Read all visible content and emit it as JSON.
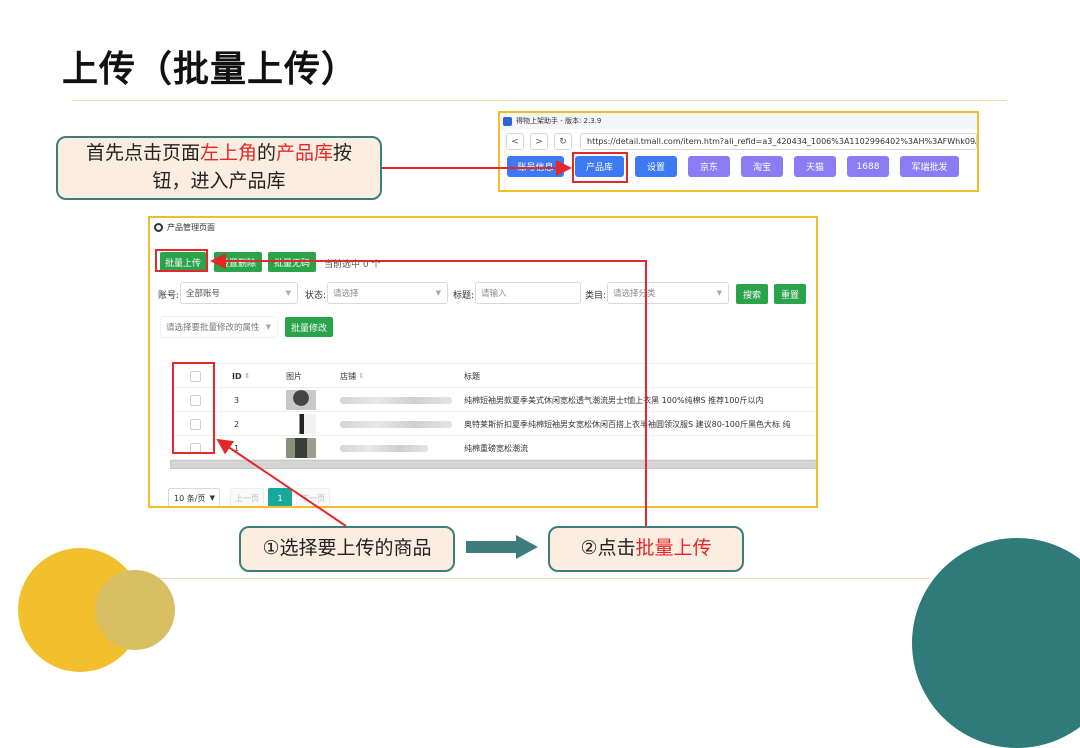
{
  "slide": {
    "title": "上传（批量上传）",
    "callout1": {
      "p1": "首先点击页面",
      "r1": "左上角",
      "p2": "的",
      "r2": "产品库",
      "p3": "按",
      "line2": "钮，进入产品库"
    },
    "callout2": "①选择要上传的商品",
    "callout3": {
      "prefix": "②点击",
      "highlight": "批量上传"
    }
  },
  "colors": {
    "accent_red": "#e4272b",
    "teal": "#3d7e7d",
    "callout_bg": "#fbeee0",
    "green": "#2aa34a",
    "blue_tab": "#3d79f2",
    "purple_tab": "#8b7cf3",
    "border_gold": "#f1bd2a"
  },
  "top_app": {
    "title": "得物上架助手 - 版本: 2.3.9",
    "nav": {
      "back": "<",
      "forward": ">",
      "refresh": "↻"
    },
    "url": "https://detail.tmall.com/item.htm?ali_refid=a3_420434_1006%3A1102996402%3AH%3AFWhk09A41iS",
    "tabs": [
      {
        "label": "账号信息"
      },
      {
        "label": "产品库"
      },
      {
        "label": "设置"
      },
      {
        "label": "京东"
      },
      {
        "label": "淘宝"
      },
      {
        "label": "天猫"
      },
      {
        "label": "1688"
      },
      {
        "label": "军瑞批发"
      }
    ]
  },
  "product_page": {
    "title": "产品管理页面",
    "actions": {
      "batch_upload": "批量上传",
      "btn2": "设置删除",
      "btn3": "批量无码",
      "selected": "当前选中 0 个"
    },
    "filters": {
      "account_label": "账号:",
      "account_value": "全部账号",
      "status_label": "状态:",
      "status_placeholder": "请选择",
      "title_label": "标题:",
      "title_placeholder": "请输入",
      "category_label": "类目:",
      "category_placeholder": "请选择分类",
      "search": "搜索",
      "reset": "重置"
    },
    "batch_edit": {
      "placeholder": "请选择要批量修改的属性",
      "button": "批量修改"
    },
    "table": {
      "headers": {
        "id": "ID",
        "image": "图片",
        "shop": "店铺",
        "title": "标题"
      },
      "rows": [
        {
          "id": "3",
          "title": "纯棉短袖男款夏季美式休闲宽松透气潮流男士t恤上衣黑 100%纯棉S 推荐100斤以内"
        },
        {
          "id": "2",
          "title": "奥特莱斯折扣夏季纯棉短袖男女宽松休闲百搭上衣半袖圆领汉服S 建议80-100斤黑色大标 纯"
        },
        {
          "id": "1",
          "title": "纯棉重磅宽松潮流"
        }
      ]
    },
    "pagination": {
      "page_size": "10 条/页",
      "prev": "上一页",
      "current": "1",
      "next": "下一页"
    }
  }
}
